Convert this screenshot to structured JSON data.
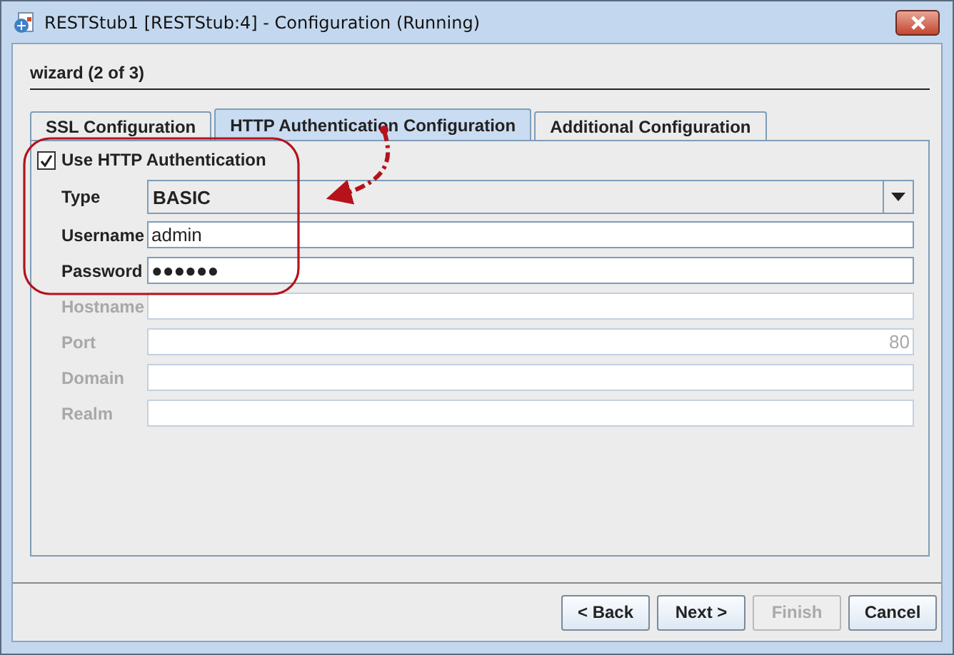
{
  "window": {
    "title": "RESTStub1 [RESTStub:4] - Configuration (Running)"
  },
  "wizard": {
    "heading": "wizard (2 of 3)"
  },
  "tabs": [
    {
      "label": "SSL Configuration",
      "selected": false
    },
    {
      "label": "HTTP Authentication Configuration",
      "selected": true
    },
    {
      "label": "Additional Configuration",
      "selected": false
    }
  ],
  "use_auth": {
    "label": "Use HTTP Authentication",
    "checked": true
  },
  "fields": [
    {
      "kind": "dropdown",
      "label": "Type",
      "value": "BASIC",
      "disabled": false
    },
    {
      "kind": "text",
      "label": "Username",
      "value": "admin",
      "disabled": false
    },
    {
      "kind": "text",
      "label": "Password",
      "value": "●●●●●●",
      "disabled": false
    },
    {
      "kind": "text",
      "label": "Hostname",
      "disabled": true
    },
    {
      "kind": "number",
      "label": "Port",
      "value": "80",
      "disabled": true
    },
    {
      "kind": "text",
      "label": "Domain",
      "disabled": true
    },
    {
      "kind": "text",
      "label": "Realm",
      "disabled": true
    }
  ],
  "callout": true,
  "buttons": [
    {
      "label": "< Back",
      "disabled": false
    },
    {
      "label": "Next >",
      "disabled": false
    },
    {
      "label": "Finish",
      "disabled": true
    },
    {
      "label": "Cancel",
      "disabled": false
    }
  ]
}
